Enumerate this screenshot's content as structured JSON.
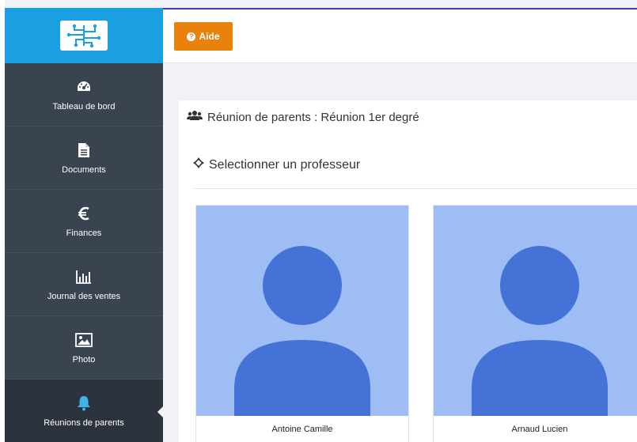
{
  "sidebar": {
    "items": [
      {
        "label": "Tableau de bord",
        "icon": "dashboard-icon"
      },
      {
        "label": "Documents",
        "icon": "document-icon"
      },
      {
        "label": "Finances",
        "icon": "euro-icon"
      },
      {
        "label": "Journal des ventes",
        "icon": "bar-chart-icon"
      },
      {
        "label": "Photo",
        "icon": "image-icon"
      },
      {
        "label": "Réunions de parents",
        "icon": "bell-icon",
        "active": true
      }
    ]
  },
  "header": {
    "help_label": "Aide"
  },
  "main": {
    "title": "Réunion de parents : Réunion 1er degré",
    "section_title": "Selectionner un professeur",
    "teachers": [
      {
        "name": "Antoine Camille"
      },
      {
        "name": "Arnaud Lucien"
      }
    ]
  },
  "colors": {
    "sidebar_bg": "#3a4350",
    "logo_bar": "#1aa0e0",
    "help_button": "#e8820c",
    "avatar_bg": "#9ebdf5",
    "avatar_fg": "#4472d6"
  }
}
